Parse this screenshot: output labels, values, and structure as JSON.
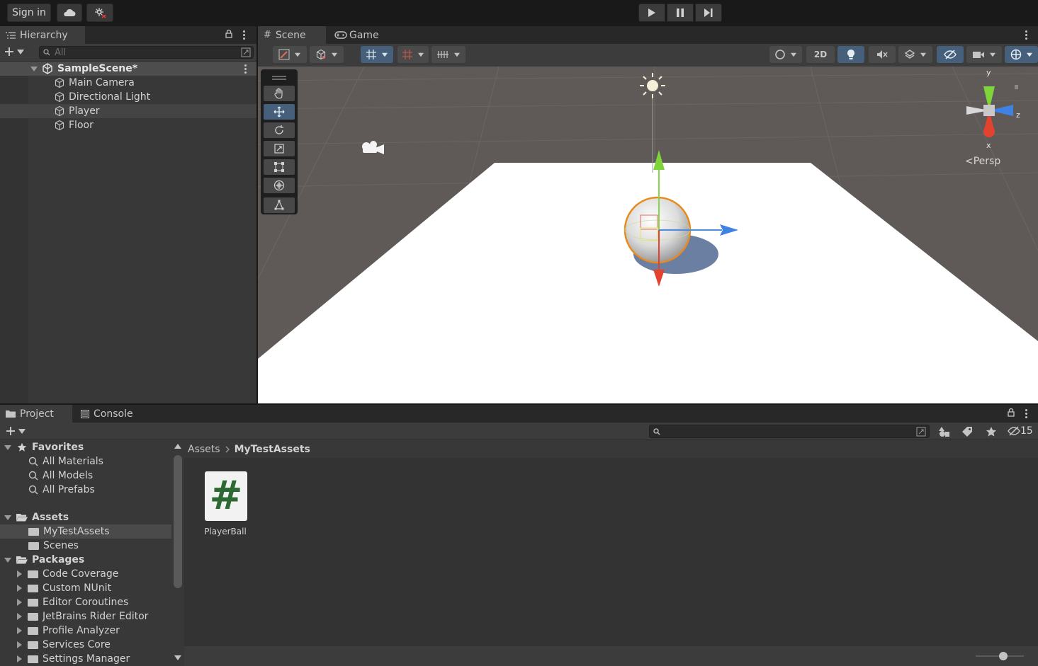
{
  "toolbar": {
    "sign_in": "Sign in",
    "cloud_icon": "cloud-icon",
    "collab_icon": "collab-icon",
    "play_icon": "play-icon",
    "pause_icon": "pause-icon",
    "step_icon": "step-icon"
  },
  "hierarchy": {
    "tab_label": "Hierarchy",
    "search_placeholder": "All",
    "scene_name": "SampleScene*",
    "items": [
      {
        "label": "Main Camera"
      },
      {
        "label": "Directional Light"
      },
      {
        "label": "Player"
      },
      {
        "label": "Floor"
      }
    ]
  },
  "scene_view": {
    "tabs": [
      {
        "label": "Scene"
      },
      {
        "label": "Game"
      }
    ],
    "btn_2d": "2D",
    "persp_label": "Persp",
    "gizmo_axes": {
      "y": "y",
      "z": "z",
      "x": "x"
    }
  },
  "project": {
    "tabs": [
      {
        "label": "Project"
      },
      {
        "label": "Console"
      }
    ],
    "hidden_count": "15",
    "breadcrumb": [
      "Assets",
      "MyTestAssets"
    ],
    "favorites": {
      "label": "Favorites",
      "items": [
        {
          "label": "All Materials"
        },
        {
          "label": "All Models"
        },
        {
          "label": "All Prefabs"
        }
      ]
    },
    "assets": {
      "label": "Assets",
      "items": [
        {
          "label": "MyTestAssets"
        },
        {
          "label": "Scenes"
        }
      ]
    },
    "packages": {
      "label": "Packages",
      "items": [
        {
          "label": "Code Coverage"
        },
        {
          "label": "Custom NUnit"
        },
        {
          "label": "Editor Coroutines"
        },
        {
          "label": "JetBrains Rider Editor"
        },
        {
          "label": "Profile Analyzer"
        },
        {
          "label": "Services Core"
        },
        {
          "label": "Settings Manager"
        }
      ]
    },
    "files": [
      {
        "label": "PlayerBall",
        "glyph": "#"
      }
    ]
  }
}
